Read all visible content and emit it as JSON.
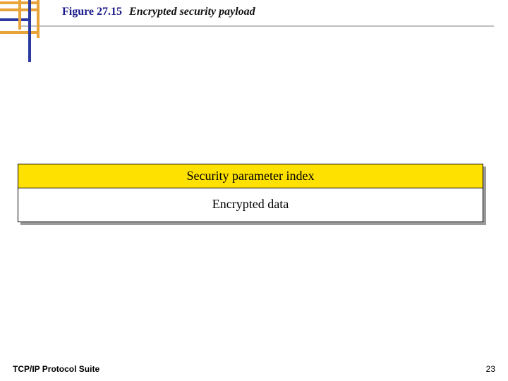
{
  "header": {
    "figure_label": "Figure 27.15",
    "figure_title": "Encrypted security payload"
  },
  "decor": {
    "colors": {
      "orange": "#e8a33a",
      "blue": "#2a3aa0"
    }
  },
  "diagram": {
    "rows": {
      "spi": "Security parameter index",
      "data": "Encrypted data"
    }
  },
  "footer": {
    "left": "TCP/IP Protocol Suite",
    "page": "23"
  }
}
